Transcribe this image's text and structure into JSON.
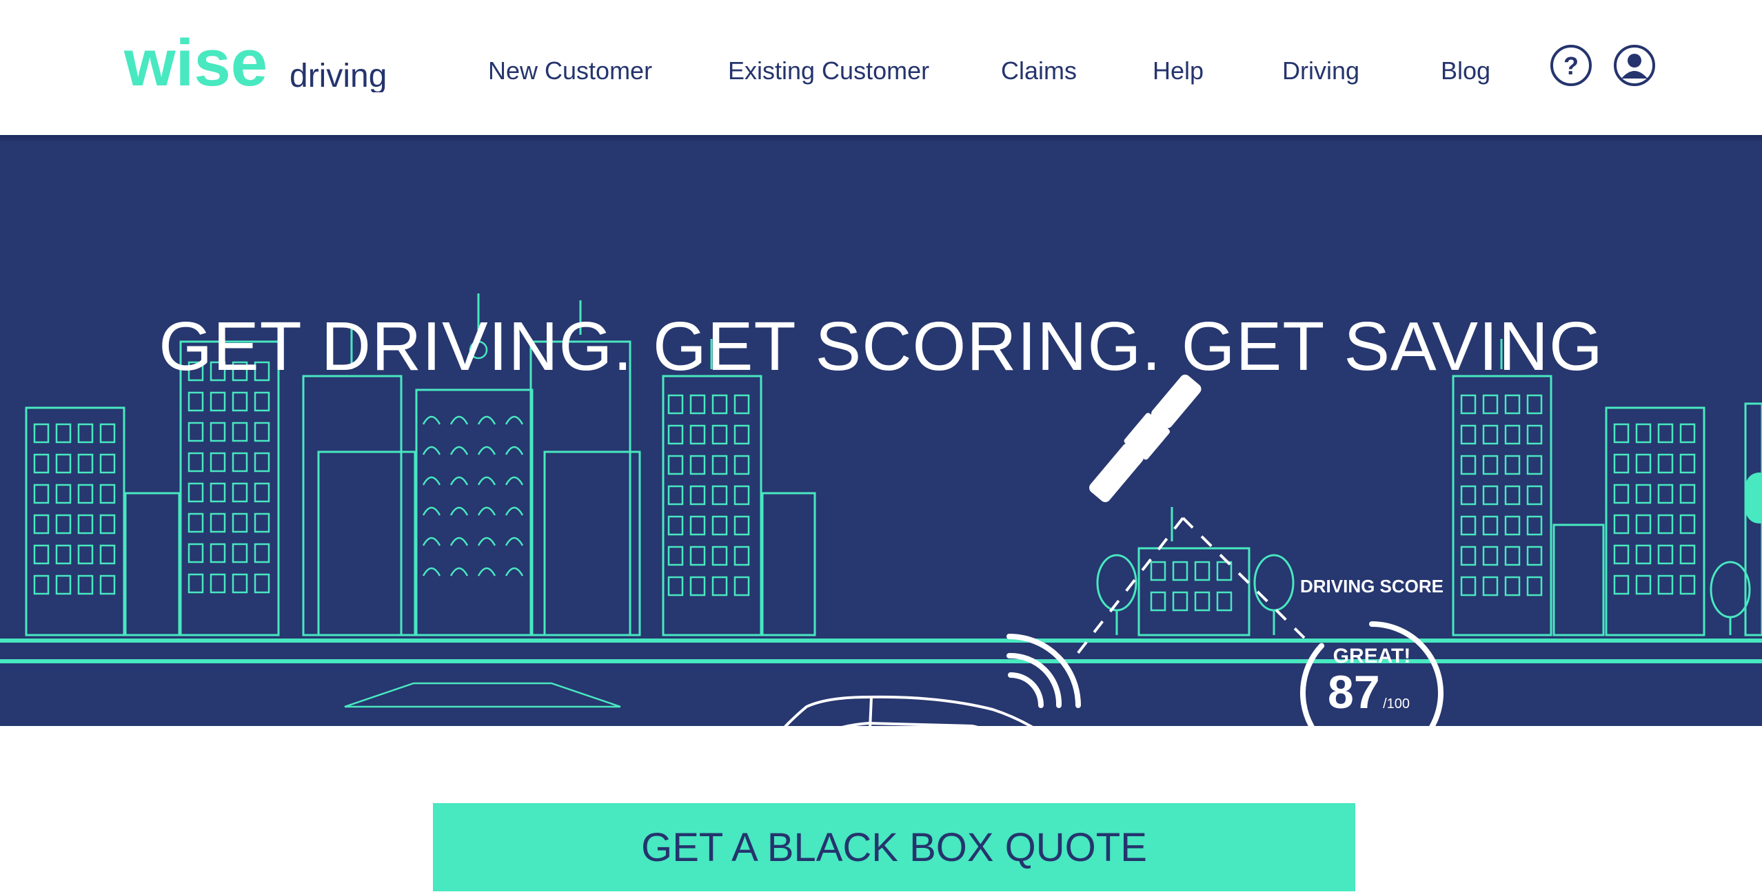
{
  "brand": {
    "name_main": "wise",
    "name_sub": "driving",
    "primary_color": "#48e8c0",
    "navy_color": "#27376f"
  },
  "nav": {
    "items": [
      {
        "label": "New Customer"
      },
      {
        "label": "Existing Customer"
      },
      {
        "label": "Claims"
      },
      {
        "label": "Help"
      },
      {
        "label": "Driving"
      },
      {
        "label": "Blog"
      }
    ],
    "help_icon": "question-circle-icon",
    "account_icon": "user-circle-icon"
  },
  "hero": {
    "headline": "GET DRIVING. GET SCORING. GET SAVING",
    "score": {
      "label": "DRIVING SCORE",
      "rating": "GREAT!",
      "value": "87",
      "max": "/100",
      "fraction": 0.87
    }
  },
  "cta": {
    "label": "GET A BLACK BOX QUOTE"
  }
}
